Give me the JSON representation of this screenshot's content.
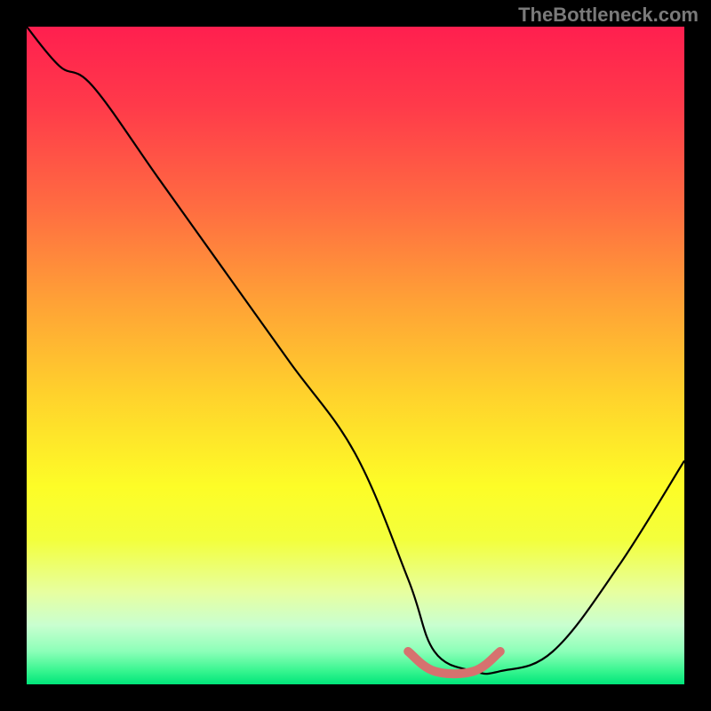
{
  "watermark": "TheBottleneck.com",
  "chart_data": {
    "type": "line",
    "title": "",
    "xlabel": "",
    "ylabel": "",
    "xlim": [
      0,
      100
    ],
    "ylim": [
      0,
      100
    ],
    "grid": false,
    "background_gradient": {
      "top": "#ff1f4f",
      "mid": "#fdfd27",
      "bottom": "#00e57a"
    },
    "series": [
      {
        "name": "bottleneck_curve",
        "color": "#000000",
        "x": [
          0,
          5,
          10,
          20,
          30,
          40,
          50,
          58,
          62,
          68,
          72,
          80,
          90,
          100
        ],
        "y": [
          100,
          94,
          91,
          77,
          63,
          49,
          35,
          16,
          5,
          2,
          2,
          5,
          18,
          34
        ]
      },
      {
        "name": "optimal_range",
        "color": "#d6726f",
        "x": [
          58,
          62,
          68,
          72
        ],
        "y": [
          5,
          2,
          2,
          5
        ]
      }
    ],
    "annotations": []
  },
  "colors": {
    "page_bg": "#000000",
    "watermark": "#7a7a7a",
    "curve": "#000000",
    "highlight": "#d6726f"
  }
}
